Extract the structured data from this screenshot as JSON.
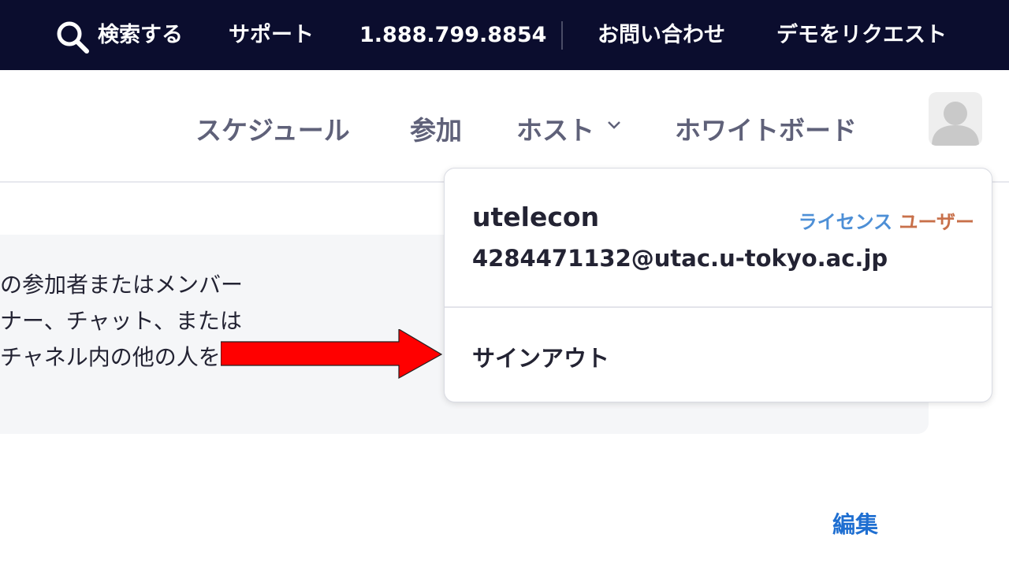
{
  "topbar": {
    "search_label": "検索する",
    "support_label": "サポート",
    "phone": "1.888.799.8854",
    "contact_label": "お問い合わせ",
    "demo_label": "デモをリクエスト"
  },
  "nav": {
    "schedule": "スケジュール",
    "join": "参加",
    "host": "ホスト",
    "whiteboard": "ホワイトボード"
  },
  "panel": {
    "lines": [
      "の参加者またはメンバー",
      "ナー、チャット、または",
      "チャネル内の他の人を"
    ]
  },
  "edit_link": "編集",
  "dropdown": {
    "username": "utelecon",
    "email": "4284471132@utac.u-tokyo.ac.jp",
    "license_part1": "ライセンス",
    "license_part2": "ユーザー",
    "signout": "サインアウト"
  },
  "colors": {
    "topbar_bg": "#0b0d2e",
    "arrow": "#ff0000",
    "license_blue": "#4d8fd6",
    "license_orange": "#c8704a"
  },
  "icons": [
    "search-icon",
    "chevron-down-icon",
    "avatar-icon",
    "arrow-annotation"
  ]
}
